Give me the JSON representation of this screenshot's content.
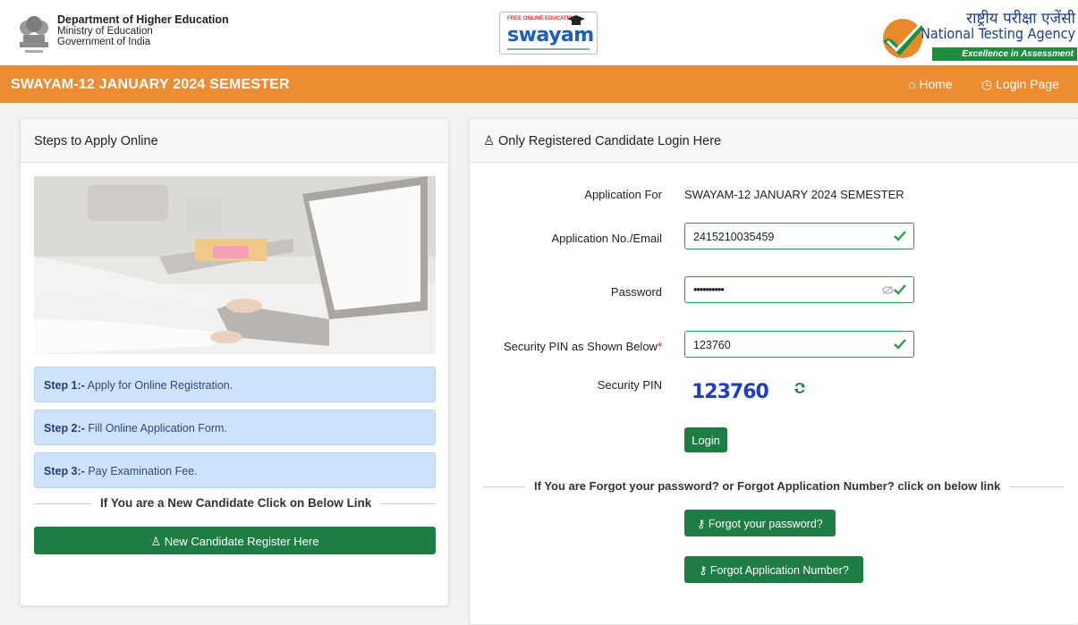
{
  "header": {
    "dept_line1": "Department of Higher Education",
    "dept_line2": "Ministry of Education",
    "dept_line3": "Government of India",
    "swayam_logo_text": "swayam",
    "swayam_tag_top": "FREE ONLINE EDUCATION",
    "nta_hindi": "राष्ट्रीय परीक्षा एजेंसी",
    "nta_english": "National Testing Agency",
    "nta_tagline": "Excellence in Assessment"
  },
  "navbar": {
    "title": "SWAYAM-12 JANUARY 2024 SEMESTER",
    "home_label": "Home",
    "login_label": "Login Page"
  },
  "left_panel": {
    "heading": "Steps to Apply Online",
    "steps": [
      {
        "bold": "Step 1:-",
        "text": " Apply for Online Registration."
      },
      {
        "bold": "Step 2:-",
        "text": " Fill Online Application Form."
      },
      {
        "bold": "Step 3:-",
        "text": " Pay Examination Fee."
      }
    ],
    "new_candidate_text": "If You are a New Candidate Click on Below Link",
    "register_button": "New Candidate Register Here"
  },
  "login_panel": {
    "heading": "Only Registered Candidate Login Here",
    "application_for_label": "Application For",
    "application_for_value": "SWAYAM-12 JANUARY 2024 SEMESTER",
    "app_no_label": "Application No./Email",
    "app_no_value": "2415210035459",
    "password_label": "Password",
    "password_value": "••••••••••",
    "pin_input_label": "Security PIN as Shown Below",
    "pin_input_required": "*",
    "pin_input_value": "123760",
    "security_pin_label": "Security PIN",
    "captcha_text": "123760",
    "login_button": "Login",
    "forgot_text": "If You are Forgot your password? or Forgot Application Number? click on below link",
    "forgot_password_button": "Forgot your password?",
    "forgot_appno_button": "Forgot Application Number?"
  },
  "colors": {
    "orange": "#ee8c31",
    "green": "#1e7d45",
    "valid_border": "#2e9a4c",
    "step_bg": "#cfe2fb"
  }
}
